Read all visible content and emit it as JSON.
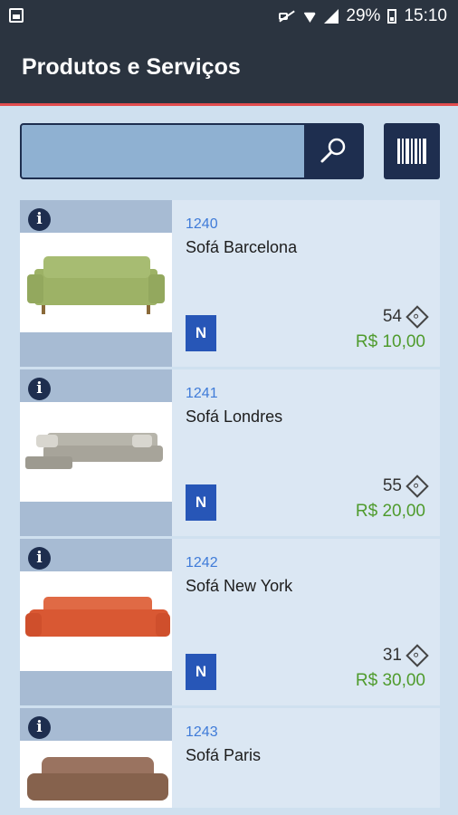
{
  "status": {
    "battery": "29%",
    "time": "15:10"
  },
  "header": {
    "title": "Produtos e Serviços"
  },
  "search": {
    "placeholder": ""
  },
  "products": [
    {
      "code": "1240",
      "name": "Sofá Barcelona",
      "badge": "N",
      "qty": "54",
      "price": "R$ 10,00",
      "sofa_color": "#9db266"
    },
    {
      "code": "1241",
      "name": "Sofá Londres",
      "badge": "N",
      "qty": "55",
      "price": "R$ 20,00",
      "sofa_color": "#a7a49a"
    },
    {
      "code": "1242",
      "name": "Sofá New York",
      "badge": "N",
      "qty": "31",
      "price": "R$ 30,00",
      "sofa_color": "#d95833"
    },
    {
      "code": "1243",
      "name": "Sofá Paris",
      "badge": "",
      "qty": "",
      "price": "",
      "sofa_color": "#86624d"
    }
  ],
  "colors": {
    "header_bg": "#2b3440",
    "accent": "#e24d4f",
    "nav_blue": "#1e2e4f",
    "link_blue": "#3f7bd8",
    "price_green": "#4f9b2d"
  }
}
